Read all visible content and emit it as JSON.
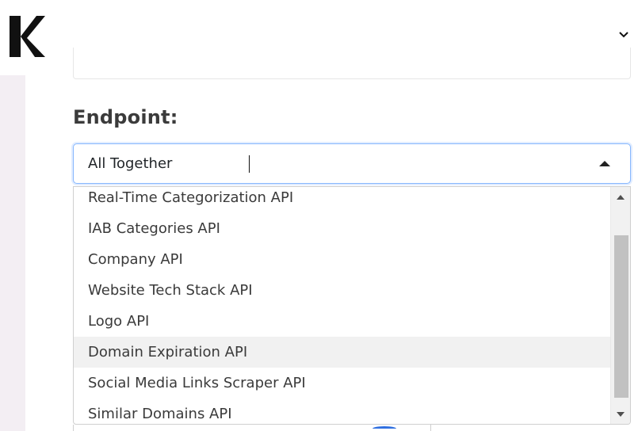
{
  "header": {
    "logo_icon": "k-logo-icon",
    "menu_icon": "chevron-down-icon"
  },
  "form": {
    "endpoint_label": "Endpoint:",
    "select_value": "All Together",
    "options": [
      "Real-Time Categorization API",
      "IAB Categories API",
      "Company API",
      "Website Tech Stack API",
      "Logo API",
      "Domain Expiration API",
      "Social Media Links Scraper API",
      "Similar Domains API"
    ],
    "highlighted_option": "Domain Expiration API"
  },
  "colors": {
    "focus_border": "#86b7fe",
    "hover_bg": "#f1f1f1",
    "sidebar_bg": "#f3eef3"
  }
}
